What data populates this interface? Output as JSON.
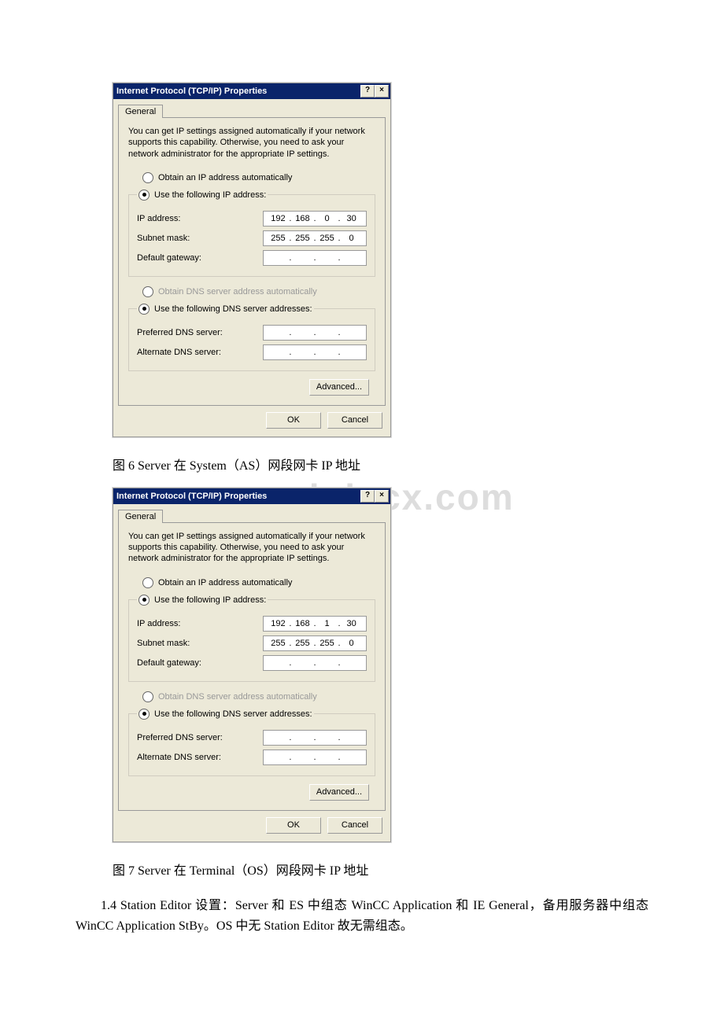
{
  "watermark": "www.bdocx.com",
  "dialog1": {
    "title": "Internet Protocol (TCP/IP) Properties",
    "help_btn": "?",
    "close_btn": "×",
    "tab": "General",
    "description": "You can get IP settings assigned automatically if your network supports this capability. Otherwise, you need to ask your network administrator for the appropriate IP settings.",
    "radio_auto_ip": "Obtain an IP address automatically",
    "radio_use_ip": "Use the following IP address:",
    "ip_label": "IP address:",
    "ip_value": [
      "192",
      "168",
      "0",
      "30"
    ],
    "subnet_label": "Subnet mask:",
    "subnet_value": [
      "255",
      "255",
      "255",
      "0"
    ],
    "gateway_label": "Default gateway:",
    "gateway_value": [
      "",
      "",
      "",
      ""
    ],
    "radio_auto_dns": "Obtain DNS server address automatically",
    "radio_use_dns": "Use the following DNS server addresses:",
    "pref_dns_label": "Preferred DNS server:",
    "pref_dns_value": [
      "",
      "",
      "",
      ""
    ],
    "alt_dns_label": "Alternate DNS server:",
    "alt_dns_value": [
      "",
      "",
      "",
      ""
    ],
    "advanced_btn": "Advanced...",
    "ok_btn": "OK",
    "cancel_btn": "Cancel"
  },
  "caption1": "图 6 Server 在 System（AS）网段网卡 IP 地址",
  "dialog2": {
    "title": "Internet Protocol (TCP/IP) Properties",
    "help_btn": "?",
    "close_btn": "×",
    "tab": "General",
    "description": "You can get IP settings assigned automatically if your network supports this capability. Otherwise, you need to ask your network administrator for the appropriate IP settings.",
    "radio_auto_ip": "Obtain an IP address automatically",
    "radio_use_ip": "Use the following IP address:",
    "ip_label": "IP address:",
    "ip_value": [
      "192",
      "168",
      "1",
      "30"
    ],
    "subnet_label": "Subnet mask:",
    "subnet_value": [
      "255",
      "255",
      "255",
      "0"
    ],
    "gateway_label": "Default gateway:",
    "gateway_value": [
      "",
      "",
      "",
      ""
    ],
    "radio_auto_dns": "Obtain DNS server address automatically",
    "radio_use_dns": "Use the following DNS server addresses:",
    "pref_dns_label": "Preferred DNS server:",
    "pref_dns_value": [
      "",
      "",
      "",
      ""
    ],
    "alt_dns_label": "Alternate DNS server:",
    "alt_dns_value": [
      "",
      "",
      "",
      ""
    ],
    "advanced_btn": "Advanced...",
    "ok_btn": "OK",
    "cancel_btn": "Cancel"
  },
  "caption2": "图 7 Server 在 Terminal（OS）网段网卡 IP 地址",
  "paragraph": "1.4 Station Editor 设置：Server 和 ES 中组态 WinCC Application 和 IE General，备用服务器中组态 WinCC Application StBy。OS 中无 Station Editor 故无需组态。"
}
